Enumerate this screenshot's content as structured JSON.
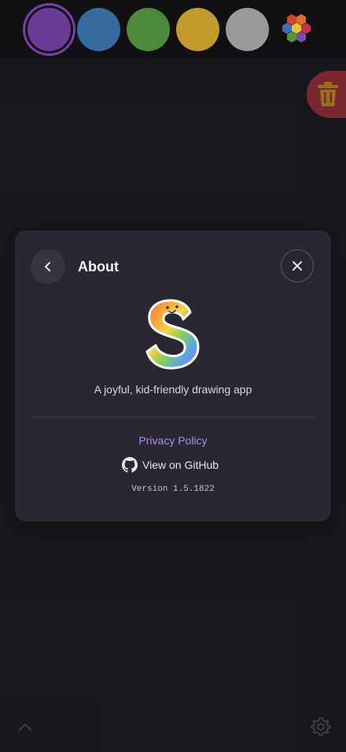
{
  "toolbar": {
    "swatches": [
      {
        "name": "purple",
        "color": "#6a3c97",
        "selected": true
      },
      {
        "name": "blue",
        "color": "#356ba0"
      },
      {
        "name": "green",
        "color": "#4e8a3c"
      },
      {
        "name": "yellow",
        "color": "#c39b2c"
      },
      {
        "name": "gray",
        "color": "#9a9a9a"
      }
    ],
    "palette_icon": "hexagon-palette-icon",
    "trash_icon": "trash-icon"
  },
  "about_dialog": {
    "title": "About",
    "back_icon": "chevron-left-icon",
    "close_icon": "close-icon",
    "logo_icon": "rainbow-s-logo",
    "tagline": "A joyful, kid-friendly drawing app",
    "privacy_label": "Privacy Policy",
    "github_label": "View on GitHub",
    "github_icon": "github-icon",
    "version": "Version 1.5.1822"
  },
  "bottom_bar": {
    "expand_icon": "chevron-up-icon",
    "settings_icon": "gear-icon"
  },
  "colors": {
    "accent_link": "#b58bf0",
    "dialog_bg": "#272831",
    "trash_bg": "#b03440"
  }
}
